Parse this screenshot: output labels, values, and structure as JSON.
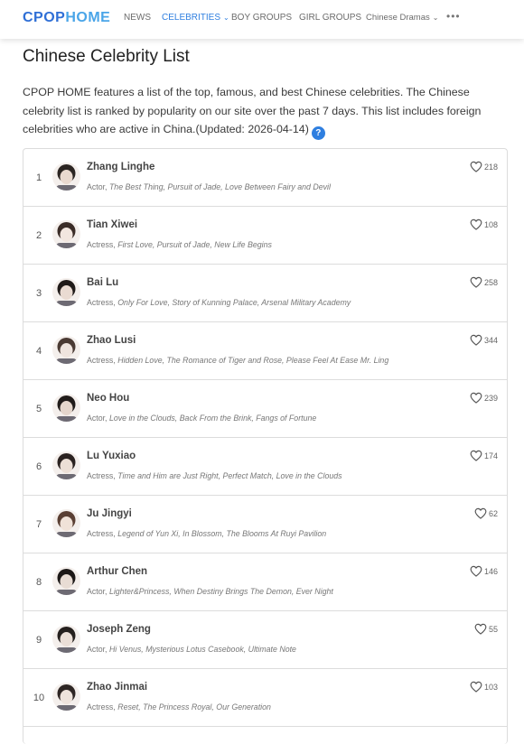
{
  "brand": {
    "part1": "CPOP",
    "part2": "HOME"
  },
  "nav": {
    "news": "NEWS",
    "celebrities": "CELEBRITIES",
    "boy_groups": "BOY GROUPS",
    "girl_groups": "GIRL GROUPS",
    "chinese_dramas": "Chinese Dramas",
    "more": "•••"
  },
  "page": {
    "title": "Chinese Celebrity List",
    "intro": "CPOP HOME features a list of the top, famous, and best Chinese celebrities. The Chinese celebrity list is ranked by popularity on our site over the past 7 days. This list includes foreign celebrities who are active in China.(Updated: 2026-04-14)",
    "help": "?"
  },
  "celebrities": [
    {
      "rank": "1",
      "name": "Zhang Linghe",
      "role": "Actor, ",
      "works": "The Best Thing, Pursuit of Jade, Love Between Fairy and Devil",
      "likes": "218"
    },
    {
      "rank": "2",
      "name": "Tian Xiwei",
      "role": "Actress, ",
      "works": "First Love, Pursuit of Jade, New Life Begins",
      "likes": "108"
    },
    {
      "rank": "3",
      "name": "Bai Lu",
      "role": "Actress, ",
      "works": "Only For Love, Story of Kunning Palace, Arsenal Military Academy",
      "likes": "258"
    },
    {
      "rank": "4",
      "name": "Zhao Lusi",
      "role": "Actress, ",
      "works": "Hidden Love, The Romance of Tiger and Rose, Please Feel At Ease Mr. Ling",
      "likes": "344"
    },
    {
      "rank": "5",
      "name": "Neo Hou",
      "role": "Actor, ",
      "works": "Love in the Clouds, Back From the Brink, Fangs of Fortune",
      "likes": "239"
    },
    {
      "rank": "6",
      "name": "Lu Yuxiao",
      "role": "Actress, ",
      "works": "Time and Him are Just Right, Perfect Match, Love in the Clouds",
      "likes": "174"
    },
    {
      "rank": "7",
      "name": "Ju Jingyi",
      "role": "Actress, ",
      "works": "Legend of Yun Xi, In Blossom, The Blooms At Ruyi Pavilion",
      "likes": "62"
    },
    {
      "rank": "8",
      "name": "Arthur Chen",
      "role": "Actor, ",
      "works": "Lighter&Princess, When Destiny Brings The Demon, Ever Night",
      "likes": "146"
    },
    {
      "rank": "9",
      "name": "Joseph Zeng",
      "role": "Actor, ",
      "works": "Hi Venus, Mysterious Lotus Casebook, Ultimate Note",
      "likes": "55"
    },
    {
      "rank": "10",
      "name": "Zhao Jinmai",
      "role": "Actress, ",
      "works": "Reset, The Princess Royal, Our Generation",
      "likes": "103"
    }
  ],
  "colors": {
    "accent": "#2f7fe0",
    "border": "#dcdcdc"
  }
}
